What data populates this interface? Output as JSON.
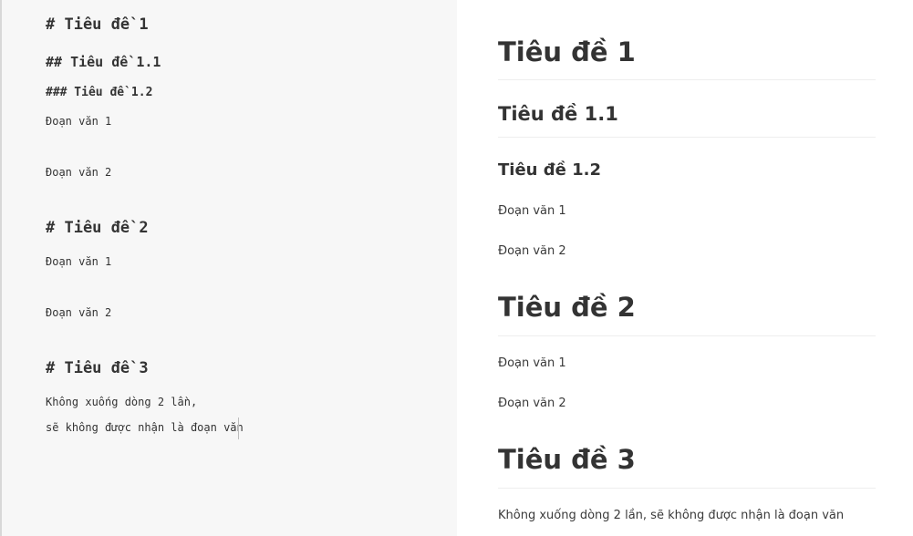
{
  "editor": {
    "lines": [
      "# Tiêu đề 1",
      "## Tiêu đề 1.1",
      "### Tiêu đề 1.2",
      "Đoạn văn 1",
      "Đoạn văn 2",
      "# Tiêu đề 2",
      "Đoạn văn 1",
      "Đoạn văn 2",
      "# Tiêu đề 3",
      "Không xuống dòng 2 lần,",
      "sẽ không được nhận là đoạn văn"
    ]
  },
  "preview": {
    "h1_a": "Tiêu đề 1",
    "h2_a": "Tiêu đề 1.1",
    "h3_a": "Tiêu đề 1.2",
    "p1_a": "Đoạn văn 1",
    "p2_a": "Đoạn văn 2",
    "h1_b": "Tiêu đề 2",
    "p1_b": "Đoạn văn 1",
    "p2_b": "Đoạn văn 2",
    "h1_c": "Tiêu đề 3",
    "p_c": "Không xuống dòng 2 lần, sẽ không được nhận là đoạn văn"
  }
}
